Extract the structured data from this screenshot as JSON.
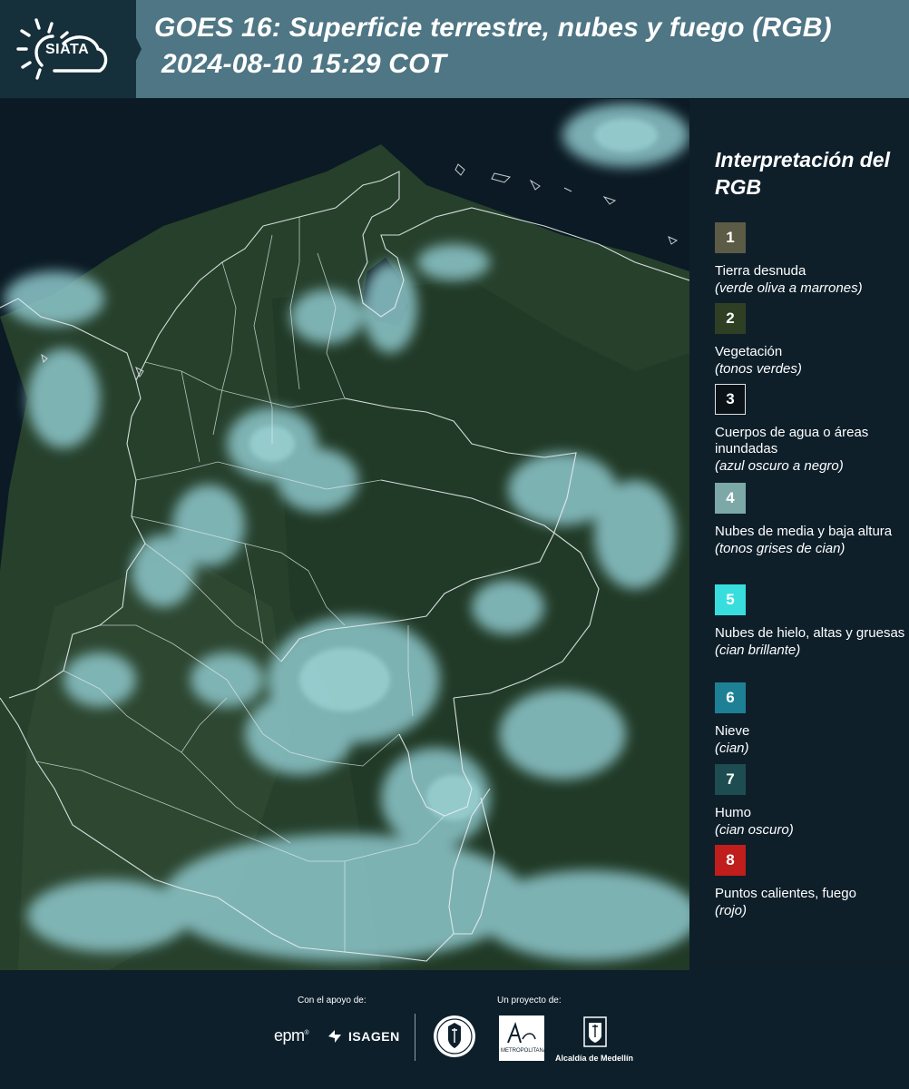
{
  "header": {
    "logo_text": "SIATA",
    "title_line1": "GOES 16: Superficie terrestre, nubes y fuego (RGB)",
    "title_line2": "2024-08-10 15:29 COT"
  },
  "legend": {
    "title": "Interpretación del RGB",
    "items": [
      {
        "number": "1",
        "label": "Tierra desnuda",
        "sublabel": "(verde oliva a marrones)",
        "color": "#5c5b45"
      },
      {
        "number": "2",
        "label": "Vegetación",
        "sublabel": "(tonos verdes)",
        "color": "#2f3f24"
      },
      {
        "number": "3",
        "label": "Cuerpos de agua o áreas inundadas",
        "sublabel": "(azul oscuro a negro)",
        "color": "#0b1218"
      },
      {
        "number": "4",
        "label": "Nubes de media y baja altura",
        "sublabel": "(tonos grises de cian)",
        "color": "#7da8a8"
      },
      {
        "number": "5",
        "label": "Nubes de hielo, altas y gruesas",
        "sublabel": "(cian brillante)",
        "color": "#38dede"
      },
      {
        "number": "6",
        "label": "Nieve",
        "sublabel": "(cian)",
        "color": "#1e8095"
      },
      {
        "number": "7",
        "label": "Humo",
        "sublabel": "(cian oscuro)",
        "color": "#1d4d50"
      },
      {
        "number": "8",
        "label": "Puntos calientes, fuego",
        "sublabel": "(rojo)",
        "color": "#c01d1d"
      }
    ]
  },
  "footer": {
    "support_label": "Con el apoyo de:",
    "project_label": "Un proyecto de:",
    "sponsor_epm": "epm",
    "sponsor_isagen": "ISAGEN",
    "partner_metro": "METROPOLITANA Valle de Aburrá",
    "partner_alcaldia": "Alcaldía de Medellín"
  },
  "colors": {
    "header_bg": "#4e7684",
    "logo_bg": "#16303b",
    "page_bg": "#0d1f2b",
    "ocean": "#0b1a24",
    "land": "#2a4330",
    "cloud": "#8ec8cc",
    "border": "#e8eef0"
  }
}
